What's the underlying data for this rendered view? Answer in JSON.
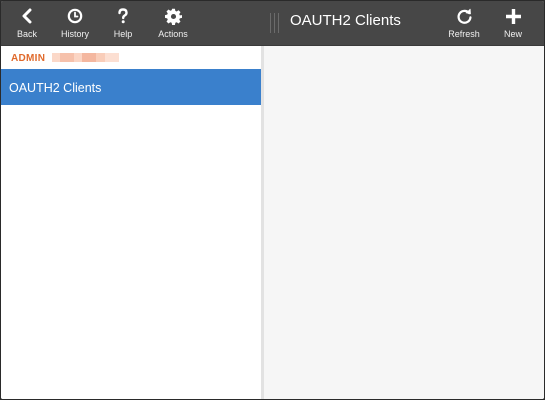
{
  "left_toolbar": {
    "buttons": [
      {
        "label": "Back",
        "icon": "chevron-left-icon"
      },
      {
        "label": "History",
        "icon": "clock-icon"
      },
      {
        "label": "Help",
        "icon": "question-icon"
      },
      {
        "label": "Actions",
        "icon": "gear-icon"
      }
    ]
  },
  "right_toolbar": {
    "title": "OAUTH2 Clients",
    "buttons": [
      {
        "label": "Refresh",
        "icon": "refresh-icon"
      },
      {
        "label": "New",
        "icon": "plus-icon"
      }
    ]
  },
  "sidebar": {
    "section_label": "ADMIN",
    "items": [
      {
        "label": "OAUTH2 Clients",
        "selected": true
      }
    ]
  },
  "colors": {
    "toolbar_bg": "#474747",
    "selected_item_bg": "#3a80cc",
    "section_label": "#e06a2c"
  }
}
